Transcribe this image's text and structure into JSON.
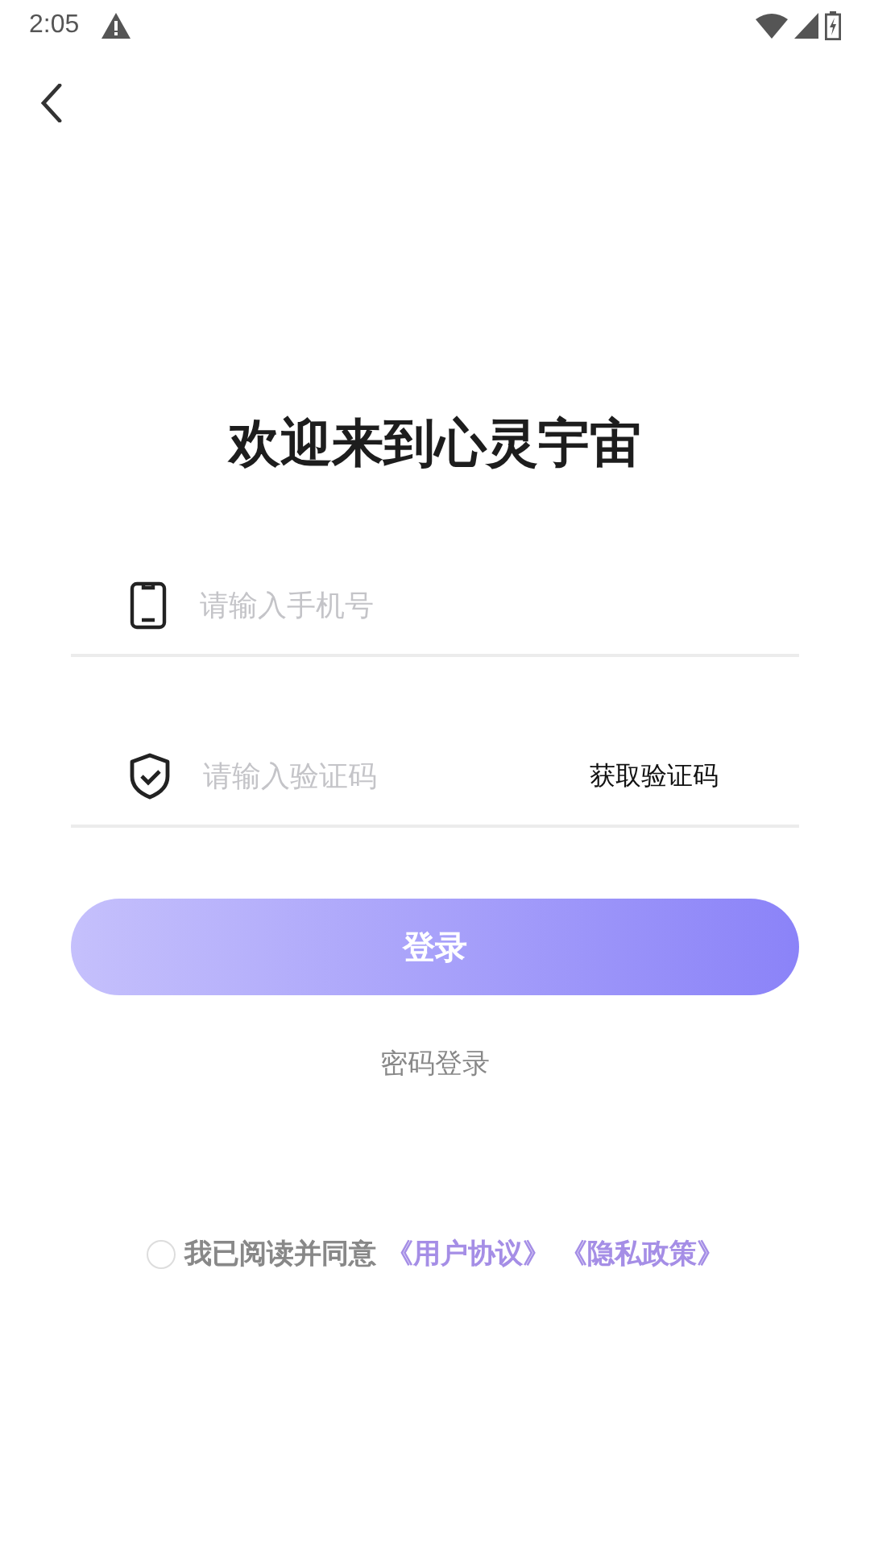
{
  "status_bar": {
    "time": "2:05"
  },
  "title": "欢迎来到心灵宇宙",
  "fields": [
    {
      "kind": "phone",
      "placeholder": "请输入手机号"
    },
    {
      "kind": "code",
      "placeholder": "请输入验证码",
      "action": "获取验证码"
    }
  ],
  "login_button": "登录",
  "password_login": "密码登录",
  "agreement": {
    "checked": false,
    "text": "我已阅读并同意",
    "links": [
      "《用户协议》",
      "《隐私政策》"
    ]
  }
}
